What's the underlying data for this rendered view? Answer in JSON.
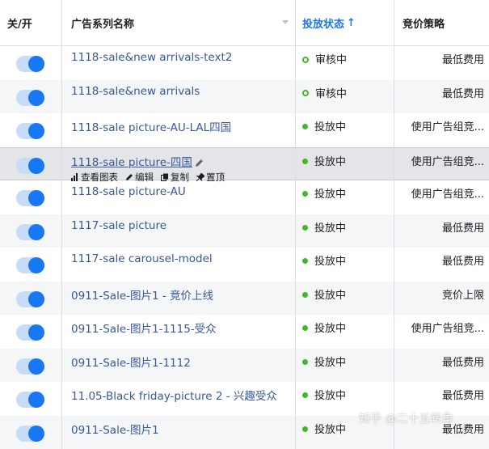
{
  "header": {
    "toggle": "关/开",
    "name": "广告系列名称",
    "status": "投放状态",
    "status_arrow": "↑",
    "bid": "竞价策略"
  },
  "rows": [
    {
      "name": "1118-sale&new arrivals-text2",
      "status": "审核中",
      "status_kind": "review",
      "bid": "最低费用"
    },
    {
      "name": "1118-sale&new arrivals",
      "status": "审核中",
      "status_kind": "review",
      "bid": "最低费用"
    },
    {
      "name": "1118-sale picture-AU-LAL四国",
      "status": "投放中",
      "status_kind": "active",
      "bid": "使用广告组竞..."
    },
    {
      "name": "1118-sale picture-四国",
      "status": "投放中",
      "status_kind": "active",
      "bid": "使用广告组竞...",
      "actions": {
        "chart": "查看图表",
        "edit": "编辑",
        "copy": "复制",
        "pin": "置顶"
      }
    },
    {
      "name": "1118-sale picture-AU",
      "status": "投放中",
      "status_kind": "active",
      "bid": "使用广告组竞..."
    },
    {
      "name": "1117-sale picture",
      "status": "投放中",
      "status_kind": "active",
      "bid": "最低费用"
    },
    {
      "name": "1117-sale carousel-model",
      "status": "投放中",
      "status_kind": "active",
      "bid": "最低费用"
    },
    {
      "name": "0911-Sale-图片1 - 竞价上线",
      "status": "投放中",
      "status_kind": "active",
      "bid": "竞价上限"
    },
    {
      "name": "0911-Sale-图片1-1115-受众",
      "status": "投放中",
      "status_kind": "active",
      "bid": "使用广告组竞..."
    },
    {
      "name": "0911-Sale-图片1-1112",
      "status": "投放中",
      "status_kind": "active",
      "bid": "最低费用"
    },
    {
      "name": "11.05-Black friday-picture 2 - 兴趣受众",
      "status": "投放中",
      "status_kind": "active",
      "bid": "最低费用"
    },
    {
      "name": "0911-Sale-图片1",
      "status": "投放中",
      "status_kind": "active",
      "bid": "最低费用"
    }
  ],
  "watermark": "知乎 @二十五转角",
  "colors": {
    "accent": "#1877f2",
    "active": "#42b72a",
    "link": "#385898"
  }
}
